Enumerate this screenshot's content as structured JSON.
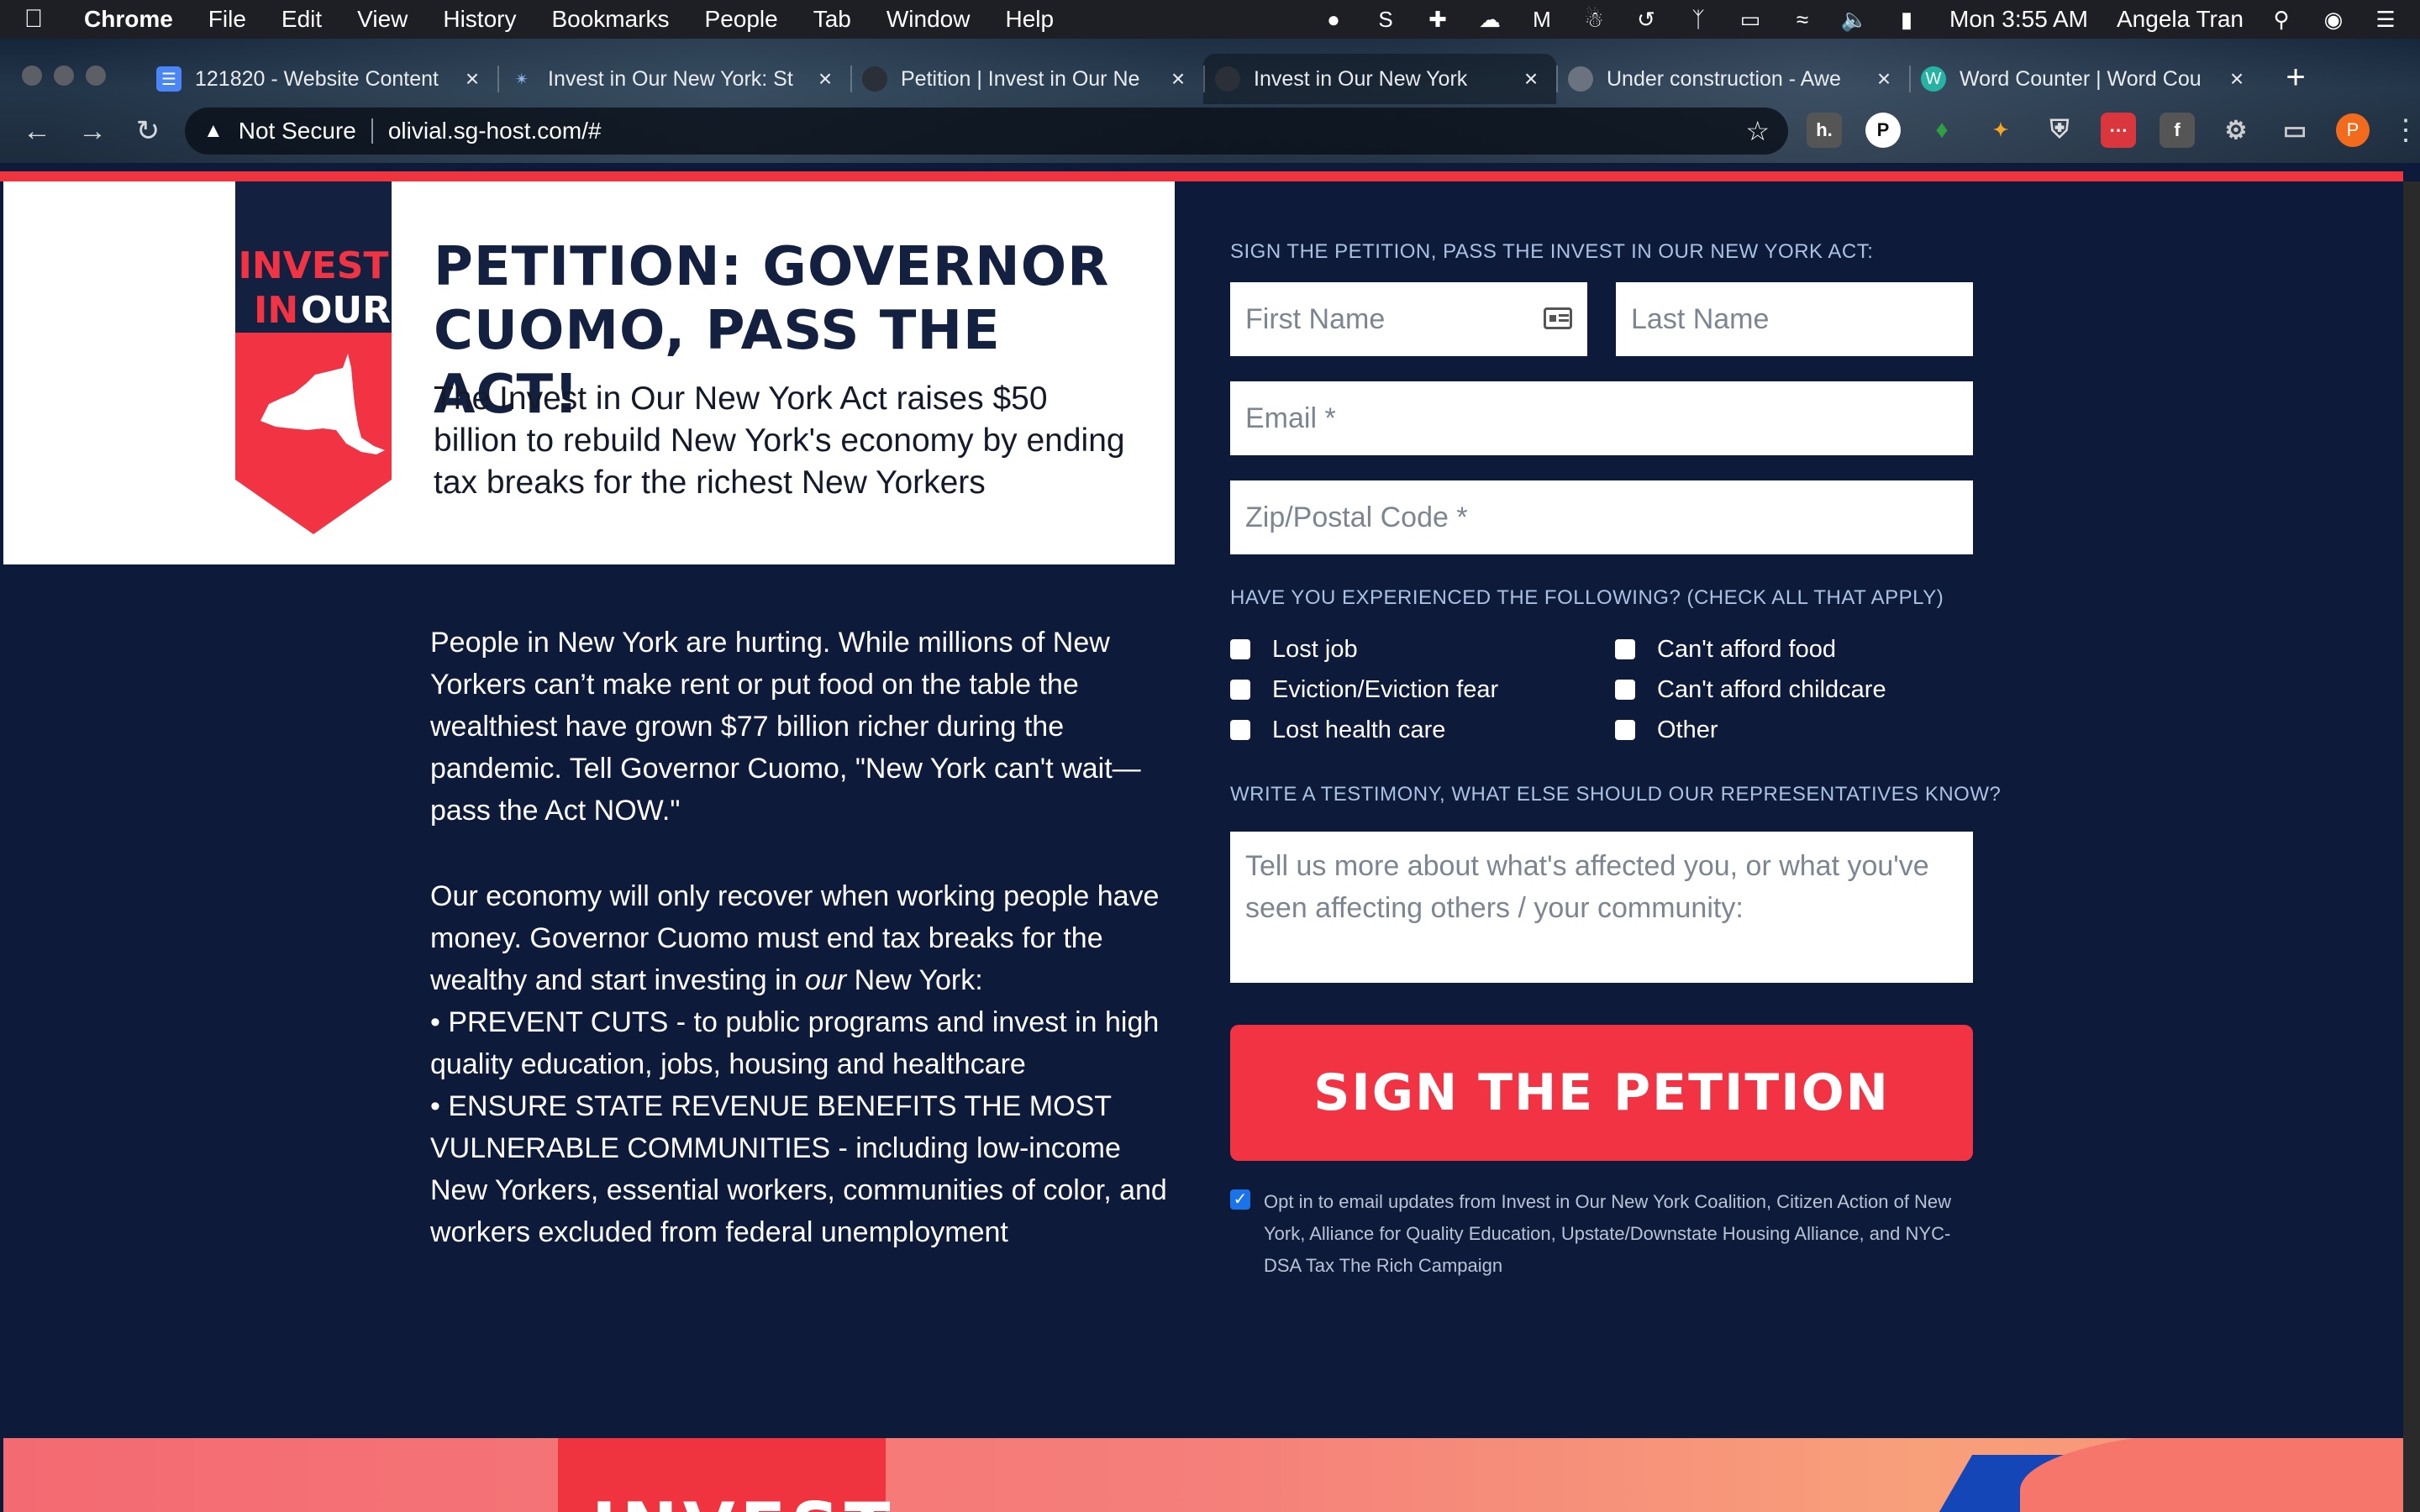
{
  "menubar": {
    "app": "Chrome",
    "items": [
      "File",
      "Edit",
      "View",
      "History",
      "Bookmarks",
      "People",
      "Tab",
      "Window",
      "Help"
    ],
    "clock": "Mon 3:55 AM",
    "user": "Angela Tran"
  },
  "tabs": [
    {
      "title": "121820 - Website Content",
      "icon": "google-docs-icon",
      "color": "#4a86f5"
    },
    {
      "title": "Invest in Our New York: St",
      "icon": "star-badge-icon",
      "color": "#3a6ea5"
    },
    {
      "title": "Petition | Invest in Our Ne",
      "icon": "globe-icon",
      "color": "#2a2f38"
    },
    {
      "title": "Invest in Our New York",
      "icon": "globe-icon",
      "color": "#2a2f38"
    },
    {
      "title": "Under construction - Awe",
      "icon": "globe-icon",
      "color": "#6b7380"
    },
    {
      "title": "Word Counter | Word Cou",
      "icon": "word-counter-icon",
      "color": "#27b3a3"
    }
  ],
  "browser": {
    "security": "Not Secure",
    "url": "olivial.sg-host.com/#",
    "profile_initial": "P"
  },
  "hero": {
    "logo_line1": "INVEST",
    "logo_line2a": "IN",
    "logo_line2b": "OUR",
    "headline": "PETITION: GOVERNOR CUOMO, PASS THE ACT!",
    "subhead": "The Invest in Our New York Act raises $50 billion to rebuild New York's economy by ending tax breaks for the richest New Yorkers"
  },
  "body": {
    "p1": "People in New York are hurting. While millions of New Yorkers can’t make rent or put food on the table the wealthiest have grown $77 billion richer during the pandemic. Tell Governor Cuomo, \"New York can't wait—pass the Act NOW.\"",
    "p2_a": "Our economy will only recover when working people have money. Governor Cuomo must end tax breaks for the wealthy and start investing in ",
    "p2_em": "our",
    "p2_b": " New York:",
    "bullet1": "• PREVENT CUTS - to public programs and invest in high quality education, jobs, housing and healthcare",
    "bullet2": "• ENSURE STATE REVENUE BENEFITS THE MOST VULNERABLE COMMUNITIES - including low-income New Yorkers, essential workers, communities of color, and workers excluded from federal unemployment"
  },
  "form": {
    "section_label": "SIGN THE PETITION, PASS THE INVEST IN OUR NEW YORK ACT:",
    "first_name_placeholder": "First Name",
    "last_name_placeholder": "Last Name",
    "email_placeholder": "Email *",
    "zip_placeholder": "Zip/Postal Code *",
    "checks_label": "HAVE YOU EXPERIENCED THE FOLLOWING? (CHECK ALL THAT APPLY)",
    "checks": [
      "Lost job",
      "Can't afford food",
      "Eviction/Eviction fear",
      "Can't afford childcare",
      "Lost health care",
      "Other"
    ],
    "testimony_label": "WRITE A TESTIMONY, WHAT ELSE SHOULD OUR REPRESENTATIVES KNOW?",
    "testimony_placeholder": "Tell us more about what's affected you, or what you've seen affecting others / your community:",
    "submit": "SIGN THE PETITION",
    "optin": "Opt in to email updates from Invest in Our New York Coalition, Citizen Action of New York, Alliance for Quality Education, Upstate/Downstate Housing Alliance, and NYC-DSA Tax The Rich Campaign",
    "optin_checked": true
  },
  "footer": {
    "partial_text": "INVEST"
  },
  "colors": {
    "navy": "#0d1a3a",
    "accent_red": "#f13343",
    "label_blue": "#a9c2e4"
  }
}
